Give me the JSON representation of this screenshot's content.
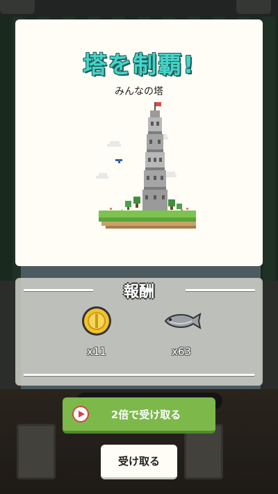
{
  "popup": {
    "title": "塔を制覇!",
    "subtitle": "みんなの塔"
  },
  "reward": {
    "heading": "報酬",
    "items": [
      {
        "icon": "gold-coin-icon",
        "quantity": "x11"
      },
      {
        "icon": "fish-icon",
        "quantity": "x63"
      }
    ]
  },
  "buttons": {
    "double": "2倍で受け取る",
    "receive": "受け取る"
  },
  "colors": {
    "title": "#45d4c8",
    "double_button": "#7cb84a",
    "play_icon": "#d64545"
  }
}
